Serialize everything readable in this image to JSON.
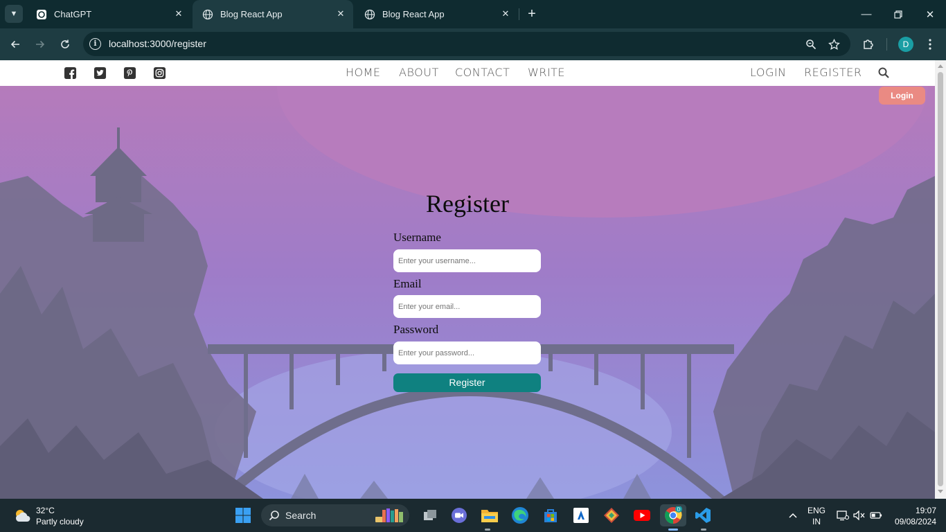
{
  "browser": {
    "tabs": [
      {
        "title": "ChatGPT",
        "active": false
      },
      {
        "title": "Blog React App",
        "active": true
      },
      {
        "title": "Blog React App",
        "active": false
      }
    ],
    "url": "localhost:3000/register",
    "profile_initial": "D"
  },
  "site": {
    "menu": [
      "HOME",
      "ABOUT",
      "CONTACT",
      "WRITE"
    ],
    "auth_links": [
      "LOGIN",
      "REGISTER"
    ],
    "social_icons": [
      "facebook-icon",
      "twitter-icon",
      "pinterest-icon",
      "instagram-icon"
    ],
    "login_button": "Login",
    "form": {
      "title": "Register",
      "username_label": "Username",
      "username_placeholder": "Enter your username...",
      "email_label": "Email",
      "email_placeholder": "Enter your email...",
      "password_label": "Password",
      "password_placeholder": "Enter your password...",
      "submit": "Register"
    }
  },
  "taskbar": {
    "weather_temp": "32°C",
    "weather_desc": "Partly cloudy",
    "search_label": "Search",
    "lang_top": "ENG",
    "lang_bottom": "IN",
    "time": "19:07",
    "date": "09/08/2024"
  },
  "colors": {
    "register_button": "#0f8180",
    "login_button": "#ea8a83",
    "browser_frame": "#0f2b30"
  }
}
